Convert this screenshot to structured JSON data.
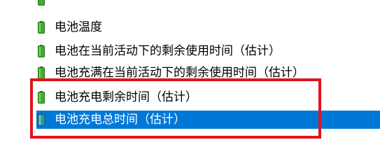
{
  "list": {
    "items": [
      {
        "label": "",
        "selected": false
      },
      {
        "label": "电池温度",
        "selected": false
      },
      {
        "label": "电池在当前活动下的剩余使用时间（估计）",
        "selected": false
      },
      {
        "label": "电池充满在当前活动下的剩余使用时间（估计）",
        "selected": false
      },
      {
        "label": "电池充电剩余时间（估计）",
        "selected": false
      },
      {
        "label": "电池充电总时间（估计）",
        "selected": true
      }
    ]
  },
  "icon": "battery-icon",
  "colors": {
    "selection": "#0078d7",
    "highlight_box": "#e0141e",
    "battery_green": "#3fae2a",
    "battery_teal": "#2e9c9c"
  }
}
